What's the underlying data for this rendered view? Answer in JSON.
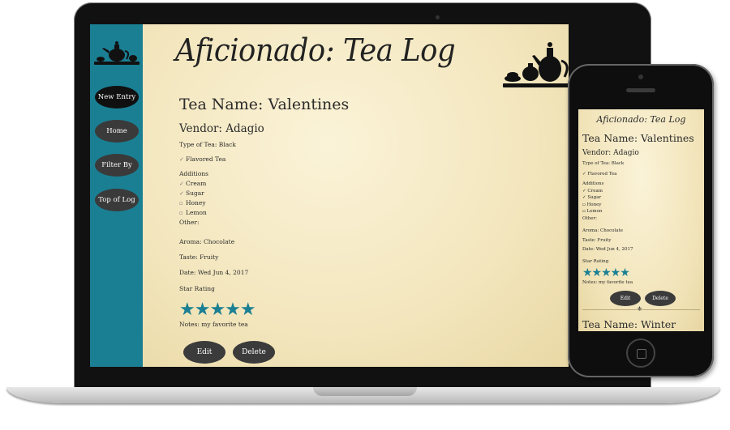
{
  "app": {
    "title": "Aficionado: Tea Log"
  },
  "sidebar": {
    "items": [
      {
        "label": "New Entry"
      },
      {
        "label": "Home"
      },
      {
        "label": "Filter By"
      },
      {
        "label": "Top of Log"
      }
    ]
  },
  "entry": {
    "tea_name": "Tea Name: Valentines",
    "vendor": "Vendor: Adagio",
    "type": "Type of Tea: Black",
    "flavored": "Flavored Tea",
    "additions_label": "Additions",
    "additions": [
      {
        "label": "Cream",
        "checked": true
      },
      {
        "label": "Sugar",
        "checked": true
      },
      {
        "label": "Honey",
        "checked": false
      },
      {
        "label": "Lemon",
        "checked": false
      }
    ],
    "other": "Other:",
    "aroma": "Aroma: Chocolate",
    "taste": "Taste: Fruity",
    "date": "Date: Wed Jun 4, 2017",
    "star_label": "Star Rating",
    "stars": "★★★★★",
    "rating": 5,
    "notes": "Notes: my favorite tea",
    "edit_label": "Edit",
    "delete_label": "Delete"
  },
  "phone": {
    "title": "Aficionado: Tea Log",
    "tea_name": "Tea Name: Valentines",
    "vendor": "Vendor: Adagio",
    "type": "Type of Tea: Black",
    "flavored": "Flavored Tea",
    "additions_label": "Additions",
    "additions": [
      "Cream",
      "Sugar",
      "Honey",
      "Lemon"
    ],
    "other": "Other:",
    "aroma": "Aroma: Chocolate",
    "taste": "Taste: Fruity",
    "date": "Date: Wed Jun 4, 2017",
    "star_label": "Star Rating",
    "stars": "★★★★★",
    "notes": "Notes: my favorite tea",
    "edit_label": "Edit",
    "delete_label": "Delete",
    "next_entry": "Tea Name: Winter"
  },
  "colors": {
    "sidebar": "#1a7f93",
    "star": "#1a7f93",
    "button": "#3b3b3b",
    "parchment": "#f5e9c2"
  }
}
